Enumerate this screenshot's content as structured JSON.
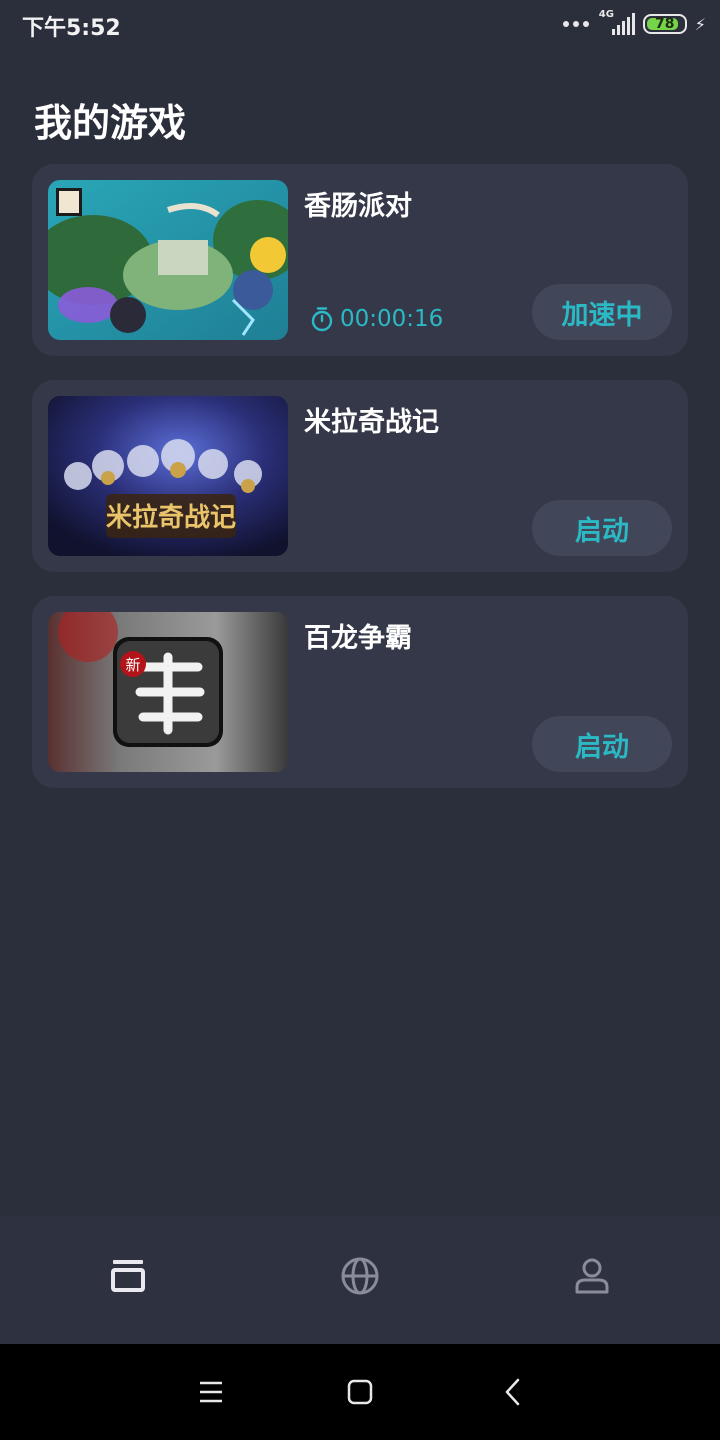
{
  "status_bar": {
    "time": "下午5:52",
    "network": "4G",
    "battery": "78",
    "battery_color": "#76d44b"
  },
  "page": {
    "title": "我的游戏"
  },
  "games": [
    {
      "name": "香肠派对",
      "button_label": "加速中",
      "timer": "00:00:16",
      "thumb_icon": "sausage-party-cover"
    },
    {
      "name": "米拉奇战记",
      "button_label": "启动",
      "thumb_icon": "miracle-war-cover",
      "thumb_text": "米拉奇战记"
    },
    {
      "name": "百龙争霸",
      "button_label": "启动",
      "thumb_icon": "three-kingdoms-cover",
      "thumb_badge": "新"
    }
  ],
  "tab_bar": {
    "tabs": [
      {
        "name": "games-tab",
        "icon": "game-library-icon",
        "active": true
      },
      {
        "name": "discover-tab",
        "icon": "globe-icon",
        "active": false
      },
      {
        "name": "profile-tab",
        "icon": "user-icon",
        "active": false
      }
    ]
  },
  "system_nav": [
    "menu-icon",
    "home-icon",
    "back-icon"
  ],
  "colors": {
    "background": "#2b2e3b",
    "card": "#353848",
    "button": "#414658",
    "accent": "#2bb9c6"
  }
}
